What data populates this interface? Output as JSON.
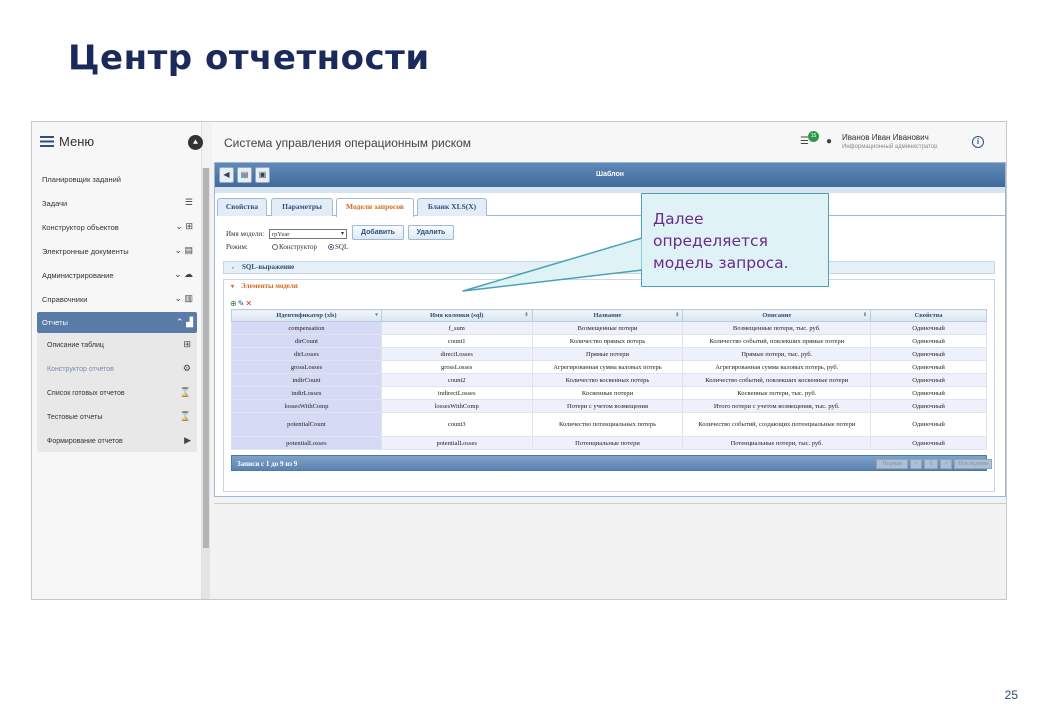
{
  "slide": {
    "title": "Центр отчетности",
    "page_number": "25"
  },
  "sidebar": {
    "menu_label": "Меню",
    "items": [
      {
        "label": "Планировщик заданий",
        "icon": ""
      },
      {
        "label": "Задачи",
        "icon": "tasks-icon"
      },
      {
        "label": "Конструктор объектов",
        "icon": "hierarchy-icon"
      },
      {
        "label": "Электронные документы",
        "icon": "document-icon"
      },
      {
        "label": "Администрирование",
        "icon": "cloud-icon"
      },
      {
        "label": "Справочники",
        "icon": "library-icon"
      },
      {
        "label": "Отчеты",
        "icon": "chart-icon",
        "active": true
      }
    ],
    "subitems": [
      {
        "label": "Описание таблиц",
        "icon": "table-icon"
      },
      {
        "label": "Конструктор отчетов",
        "icon": "gears-icon",
        "muted": true
      },
      {
        "label": "Список готовых отчетов",
        "icon": "hourglass-icon"
      },
      {
        "label": "Тестовые отчеты",
        "icon": "hourglass-icon"
      },
      {
        "label": "Формирование отчетов",
        "icon": "play-icon"
      }
    ]
  },
  "header": {
    "app_title": "Система управления операционным риском",
    "task_count": "15",
    "user_name": "Иванов Иван Иванович",
    "user_role": "Информационный администратор"
  },
  "panel": {
    "title": "Шаблон",
    "tabs": [
      "Свойства",
      "Параметры",
      "Модели запросов",
      "Бланк XLS(X)"
    ],
    "active_tab": "Модели запросов",
    "model_name_label": "Имя модели:",
    "model_name_value": "rpYear",
    "add_button": "Добавить",
    "delete_button": "Удалить",
    "mode_label": "Режим:",
    "mode_options": [
      "Конструктор",
      "SQL"
    ],
    "mode_selected": "SQL",
    "sql_section": "SQL-выражение",
    "elements_section": "Элементы модели",
    "table": {
      "columns": [
        "Идентификатор (xls)",
        "Имя колонки (sql)",
        "Название",
        "Описание",
        "Свойства"
      ],
      "rows": [
        [
          "compensation",
          "f_sum",
          "Возмещенные потери",
          "Возмещенные потери, тыс. руб.",
          "Одиночный"
        ],
        [
          "dirCount",
          "count1",
          "Количество прямых потерь",
          "Количество событий, повлекших прямые потери",
          "Одиночный"
        ],
        [
          "dirLosses",
          "directLosses",
          "Прямые потери",
          "Прямые потери, тыс. руб.",
          "Одиночный"
        ],
        [
          "grossLosses",
          "grossLosses",
          "Агрегированная сумма валовых потерь",
          "Агрегированная сумма валовых потерь, руб.",
          "Одиночный"
        ],
        [
          "indirCount",
          "count2",
          "Количество косвенных потерь",
          "Количество событий, повлекших косвенные потери",
          "Одиночный"
        ],
        [
          "indirLosses",
          "indirectLosses",
          "Косвенные потери",
          "Косвенные потери, тыс. руб.",
          "Одиночный"
        ],
        [
          "lossesWithComp",
          "lossesWithComp",
          "Потери с учетом возмещения",
          "Итого потери с учетом возмещения, тыс. руб.",
          "Одиночный"
        ],
        [
          "potentialCount",
          "count3",
          "Количество потенциальных потерь",
          "Количество событий, создающих потенциальные потери",
          "Одиночный"
        ],
        [
          "potentialLosses",
          "potentialLosses",
          "Потенциальные потери",
          "Потенциальные потери, тыс. руб.",
          "Одиночный"
        ]
      ]
    },
    "pager": {
      "info": "Записи с 1 до 9 из 9",
      "first": "Первая",
      "prev": "<",
      "page": "1",
      "next": ">",
      "last": "Последняя"
    }
  },
  "callout": {
    "lines": [
      "Далее",
      "определяется",
      "модель запроса."
    ]
  },
  "colors": {
    "accent": "#2b4f8a",
    "active_tab": "#d2691e",
    "callout_text": "#6a2a8a",
    "callout_border": "#4aa2b8"
  }
}
